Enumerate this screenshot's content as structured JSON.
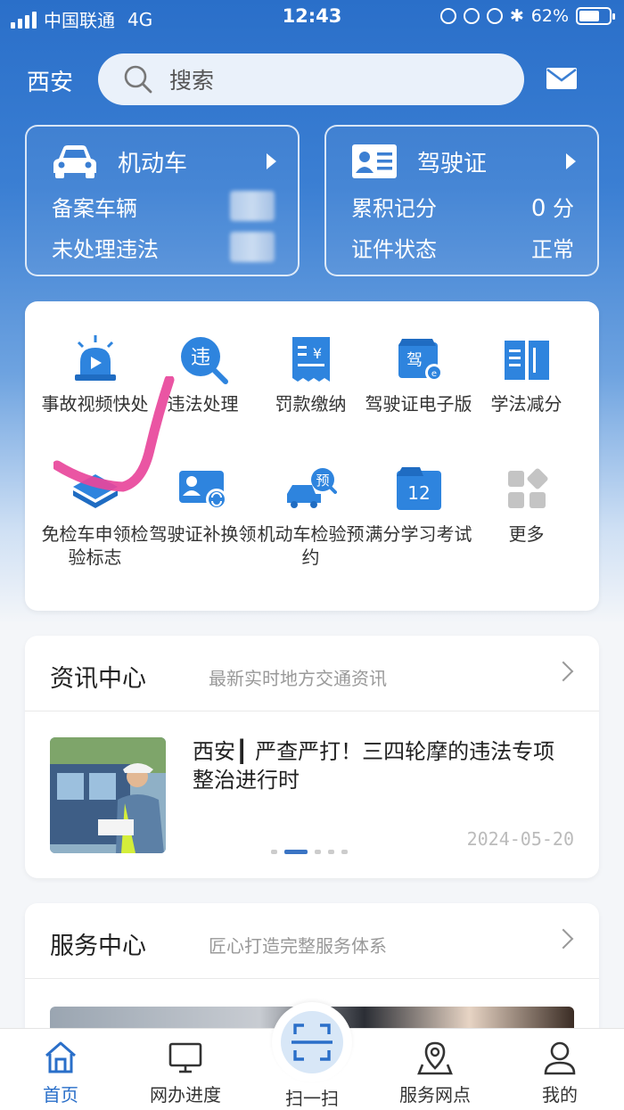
{
  "status_bar": {
    "carrier": "中国联通",
    "network": "4G",
    "time": "12:43",
    "battery": "62%"
  },
  "header": {
    "city": "西安",
    "search_placeholder": "搜索"
  },
  "vehicle_card": {
    "title": "机动车",
    "row1_label": "备案车辆",
    "row2_label": "未处理违法"
  },
  "license_card": {
    "title": "驾驶证",
    "row1_label": "累积记分",
    "row1_value": "0",
    "row1_unit": "分",
    "row2_label": "证件状态",
    "row2_value": "正常"
  },
  "services": [
    {
      "label": "事故视频快处",
      "icon": "siren-video-icon"
    },
    {
      "label": "违法处理",
      "icon": "violation-search-icon"
    },
    {
      "label": "罚款缴纳",
      "icon": "fine-receipt-icon"
    },
    {
      "label": "驾驶证电子版",
      "icon": "e-license-icon"
    },
    {
      "label": "学法减分",
      "icon": "book-icon"
    },
    {
      "label": "免检车申领检验标志",
      "icon": "exempt-sticker-icon"
    },
    {
      "label": "驾驶证补换领",
      "icon": "license-renew-icon"
    },
    {
      "label": "机动车检验预约",
      "icon": "inspection-booking-icon"
    },
    {
      "label": "满分学习考试",
      "icon": "calendar-exam-icon"
    },
    {
      "label": "更多",
      "icon": "more-grid-icon"
    }
  ],
  "news_section": {
    "title": "资讯中心",
    "subtitle": "最新实时地方交通资讯",
    "article_title": "西安┃ 严查严打！三四轮摩的违法专项整治进行时",
    "article_date": "2024-05-20"
  },
  "service_section": {
    "title": "服务中心",
    "subtitle": "匠心打造完整服务体系"
  },
  "tabbar": {
    "home": "首页",
    "progress": "网办进度",
    "scan": "扫一扫",
    "outlets": "服务网点",
    "mine": "我的"
  },
  "colors": {
    "brand_blue": "#2a6fc9",
    "icon_blue": "#2e84de",
    "annotation_pink": "#e8479b"
  }
}
